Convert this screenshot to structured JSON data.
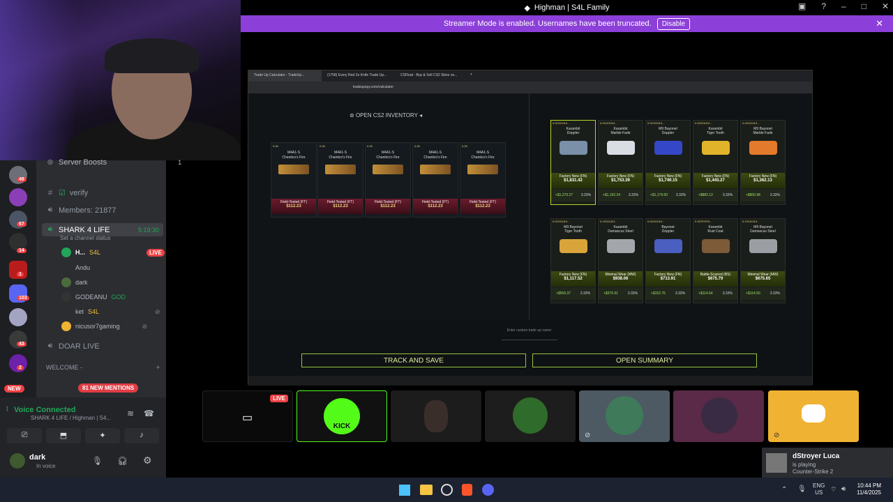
{
  "window": {
    "title": "Highman | S4L Family"
  },
  "streamer_banner": {
    "text": "Streamer Mode is enabled. Usernames have been truncated.",
    "button": "Disable"
  },
  "server_badges": [
    "49",
    "67",
    "14",
    "1",
    "103",
    "43",
    "2"
  ],
  "new_label": "NEW",
  "channels": {
    "server_boosts": "Server Boosts",
    "server_boosts_count": "1",
    "verify": "verify",
    "members": "Members: 21877",
    "voice_channel": "SHARK 4 LIFE",
    "voice_time": "5:19:30",
    "channel_status": "Set a channel status",
    "users": [
      {
        "name": "H...",
        "tag": "S4L",
        "live": "LIVE"
      },
      {
        "name": "Andu"
      },
      {
        "name": "dark"
      },
      {
        "name": "GODEANU",
        "tag": "GOD"
      },
      {
        "name": "ket",
        "tag": "S4L"
      },
      {
        "name": "nicusor7gaming"
      }
    ],
    "doar_live": "DOAR LIVE",
    "welcome": "WELCOME -",
    "mentions": "81 NEW MENTIONS"
  },
  "voice": {
    "status": "Voice Connected",
    "location": "SHARK 4 LIFE / Highman | S4...",
    "user": "dark",
    "user_status": "In voice"
  },
  "browser": {
    "tabs": [
      "Trade Up Calculator - TradeUp...",
      "(1758) Every Red Xx Knife Trade Up...",
      "CSFloat - Buy & Sell CS2 Skins on..."
    ],
    "url": "tradeupspy.com/calculator"
  },
  "calculator": {
    "open_inventory": "OPEN CS2 INVENTORY",
    "inputs": [
      {
        "float": "0.26",
        "name": "M4A1-S\nChantico's Fire",
        "condition": "Field-Tested (FT)",
        "price": "$112.23"
      },
      {
        "float": "0.26",
        "name": "M4A1-S\nChantico's Fire",
        "condition": "Field-Tested (FT)",
        "price": "$112.23"
      },
      {
        "float": "0.26",
        "name": "M4A1-S\nChantico's Fire",
        "condition": "Field-Tested (FT)",
        "price": "$112.23"
      },
      {
        "float": "0.26",
        "name": "M4A1-S\nChantico's Fire",
        "condition": "Field-Tested (FT)",
        "price": "$112.23"
      },
      {
        "float": "0.26",
        "name": "M4A1-S\nChantico's Fire",
        "condition": "Field-Tested (FT)",
        "price": "$112.23"
      }
    ],
    "outcomes": [
      {
        "float": "0.02101010...",
        "name": "Karambit\nDoppler",
        "condition": "Factory New (FN)",
        "price": "$1,831.42",
        "profit": "+$1,270.27",
        "pct": "3.33%",
        "color": "#7a8fa8"
      },
      {
        "float": "0.02101010...",
        "name": "Karambit\nMarble Fade",
        "condition": "Factory New (FN)",
        "price": "$1,753.39",
        "profit": "+$1,192.24",
        "pct": "3.33%",
        "color": "#d8dde4"
      },
      {
        "float": "0.02101010...",
        "name": "M9 Bayonet\nDoppler",
        "condition": "Factory New (FN)",
        "price": "$1,740.15",
        "profit": "+$1,179.00",
        "pct": "3.33%",
        "color": "#3447c6"
      },
      {
        "float": "0.02101010...",
        "name": "Karambit\nTiger Tooth",
        "condition": "Factory New (FN)",
        "price": "$1,443.27",
        "profit": "+$882.12",
        "pct": "3.33%",
        "color": "#e0b32a"
      },
      {
        "float": "0.02101010...",
        "name": "M9 Bayonet\nMarble Fade",
        "condition": "Factory New (FN)",
        "price": "$1,362.13",
        "profit": "+$800.98",
        "pct": "3.33%",
        "color": "#e47a2c"
      },
      {
        "float": "0.02101010...",
        "name": "M9 Bayonet\nTiger Tooth",
        "condition": "Factory New (FN)",
        "price": "$1,117.52",
        "profit": "+$556.37",
        "pct": "3.33%",
        "color": "#d9a53a"
      },
      {
        "float": "0.13131313...",
        "name": "Karambit\nDamascus Steel",
        "condition": "Minimal Wear (MW)",
        "price": "$938.06",
        "profit": "+$376.91",
        "pct": "3.33%",
        "color": "#a3a7ab"
      },
      {
        "float": "0.02101010...",
        "name": "Bayonet\nDoppler",
        "condition": "Factory New (FN)",
        "price": "$713.91",
        "profit": "+$152.76",
        "pct": "3.33%",
        "color": "#4b5fc0"
      },
      {
        "float": "0.33757575...",
        "name": "Karambit\nRust Coat",
        "condition": "Battle-Scarred (BS)",
        "price": "$675.79",
        "profit": "+$114.64",
        "pct": "3.33%",
        "color": "#7d5a38"
      },
      {
        "float": "0.13131313...",
        "name": "M9 Bayonet\nDamascus Steel",
        "condition": "Minimal Wear (MW)",
        "price": "$675.65",
        "profit": "+$114.50",
        "pct": "3.33%",
        "color": "#9b9fa4"
      }
    ],
    "custom_name_placeholder": "Enter custom trade up name:",
    "track_button": "TRACK AND SAVE",
    "summary_button": "OPEN SUMMARY"
  },
  "streams": {
    "live": "LIVE",
    "kick": "KICK"
  },
  "toast": {
    "name": "dStroyer Luca",
    "status": "is playing",
    "game": "Counter-Strike 2"
  },
  "taskbar": {
    "lang": "ENG",
    "region": "US",
    "time": "10:44 PM",
    "date": "11/4/2025"
  }
}
